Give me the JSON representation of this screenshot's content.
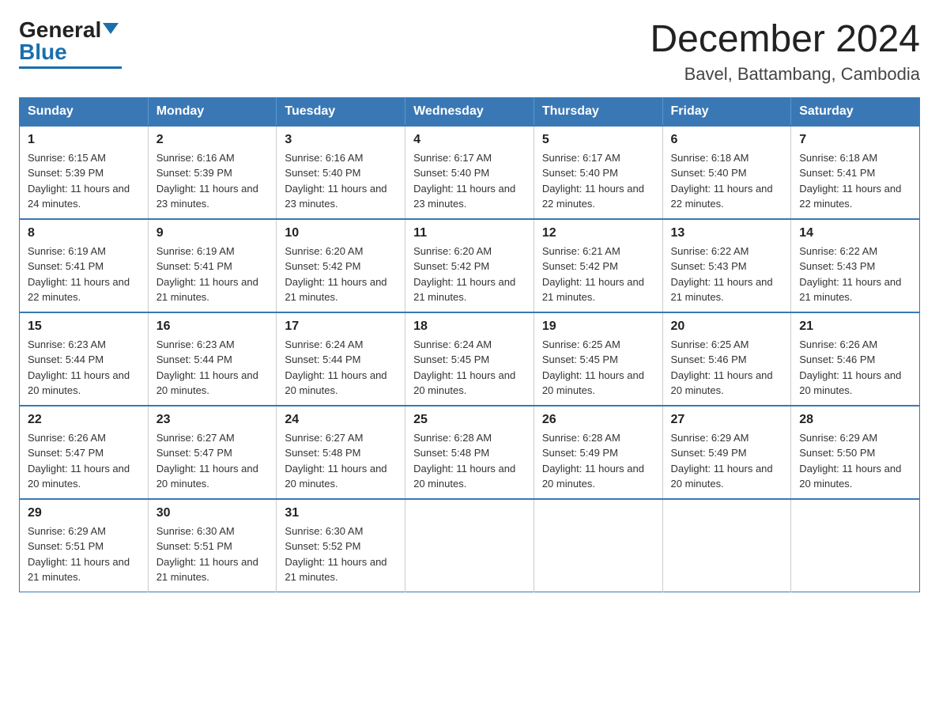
{
  "header": {
    "logo_general": "General",
    "logo_blue": "Blue",
    "month_title": "December 2024",
    "location": "Bavel, Battambang, Cambodia"
  },
  "days_of_week": [
    "Sunday",
    "Monday",
    "Tuesday",
    "Wednesday",
    "Thursday",
    "Friday",
    "Saturday"
  ],
  "weeks": [
    [
      {
        "num": "1",
        "sunrise": "6:15 AM",
        "sunset": "5:39 PM",
        "daylight": "11 hours and 24 minutes."
      },
      {
        "num": "2",
        "sunrise": "6:16 AM",
        "sunset": "5:39 PM",
        "daylight": "11 hours and 23 minutes."
      },
      {
        "num": "3",
        "sunrise": "6:16 AM",
        "sunset": "5:40 PM",
        "daylight": "11 hours and 23 minutes."
      },
      {
        "num": "4",
        "sunrise": "6:17 AM",
        "sunset": "5:40 PM",
        "daylight": "11 hours and 23 minutes."
      },
      {
        "num": "5",
        "sunrise": "6:17 AM",
        "sunset": "5:40 PM",
        "daylight": "11 hours and 22 minutes."
      },
      {
        "num": "6",
        "sunrise": "6:18 AM",
        "sunset": "5:40 PM",
        "daylight": "11 hours and 22 minutes."
      },
      {
        "num": "7",
        "sunrise": "6:18 AM",
        "sunset": "5:41 PM",
        "daylight": "11 hours and 22 minutes."
      }
    ],
    [
      {
        "num": "8",
        "sunrise": "6:19 AM",
        "sunset": "5:41 PM",
        "daylight": "11 hours and 22 minutes."
      },
      {
        "num": "9",
        "sunrise": "6:19 AM",
        "sunset": "5:41 PM",
        "daylight": "11 hours and 21 minutes."
      },
      {
        "num": "10",
        "sunrise": "6:20 AM",
        "sunset": "5:42 PM",
        "daylight": "11 hours and 21 minutes."
      },
      {
        "num": "11",
        "sunrise": "6:20 AM",
        "sunset": "5:42 PM",
        "daylight": "11 hours and 21 minutes."
      },
      {
        "num": "12",
        "sunrise": "6:21 AM",
        "sunset": "5:42 PM",
        "daylight": "11 hours and 21 minutes."
      },
      {
        "num": "13",
        "sunrise": "6:22 AM",
        "sunset": "5:43 PM",
        "daylight": "11 hours and 21 minutes."
      },
      {
        "num": "14",
        "sunrise": "6:22 AM",
        "sunset": "5:43 PM",
        "daylight": "11 hours and 21 minutes."
      }
    ],
    [
      {
        "num": "15",
        "sunrise": "6:23 AM",
        "sunset": "5:44 PM",
        "daylight": "11 hours and 20 minutes."
      },
      {
        "num": "16",
        "sunrise": "6:23 AM",
        "sunset": "5:44 PM",
        "daylight": "11 hours and 20 minutes."
      },
      {
        "num": "17",
        "sunrise": "6:24 AM",
        "sunset": "5:44 PM",
        "daylight": "11 hours and 20 minutes."
      },
      {
        "num": "18",
        "sunrise": "6:24 AM",
        "sunset": "5:45 PM",
        "daylight": "11 hours and 20 minutes."
      },
      {
        "num": "19",
        "sunrise": "6:25 AM",
        "sunset": "5:45 PM",
        "daylight": "11 hours and 20 minutes."
      },
      {
        "num": "20",
        "sunrise": "6:25 AM",
        "sunset": "5:46 PM",
        "daylight": "11 hours and 20 minutes."
      },
      {
        "num": "21",
        "sunrise": "6:26 AM",
        "sunset": "5:46 PM",
        "daylight": "11 hours and 20 minutes."
      }
    ],
    [
      {
        "num": "22",
        "sunrise": "6:26 AM",
        "sunset": "5:47 PM",
        "daylight": "11 hours and 20 minutes."
      },
      {
        "num": "23",
        "sunrise": "6:27 AM",
        "sunset": "5:47 PM",
        "daylight": "11 hours and 20 minutes."
      },
      {
        "num": "24",
        "sunrise": "6:27 AM",
        "sunset": "5:48 PM",
        "daylight": "11 hours and 20 minutes."
      },
      {
        "num": "25",
        "sunrise": "6:28 AM",
        "sunset": "5:48 PM",
        "daylight": "11 hours and 20 minutes."
      },
      {
        "num": "26",
        "sunrise": "6:28 AM",
        "sunset": "5:49 PM",
        "daylight": "11 hours and 20 minutes."
      },
      {
        "num": "27",
        "sunrise": "6:29 AM",
        "sunset": "5:49 PM",
        "daylight": "11 hours and 20 minutes."
      },
      {
        "num": "28",
        "sunrise": "6:29 AM",
        "sunset": "5:50 PM",
        "daylight": "11 hours and 20 minutes."
      }
    ],
    [
      {
        "num": "29",
        "sunrise": "6:29 AM",
        "sunset": "5:51 PM",
        "daylight": "11 hours and 21 minutes."
      },
      {
        "num": "30",
        "sunrise": "6:30 AM",
        "sunset": "5:51 PM",
        "daylight": "11 hours and 21 minutes."
      },
      {
        "num": "31",
        "sunrise": "6:30 AM",
        "sunset": "5:52 PM",
        "daylight": "11 hours and 21 minutes."
      },
      null,
      null,
      null,
      null
    ]
  ]
}
